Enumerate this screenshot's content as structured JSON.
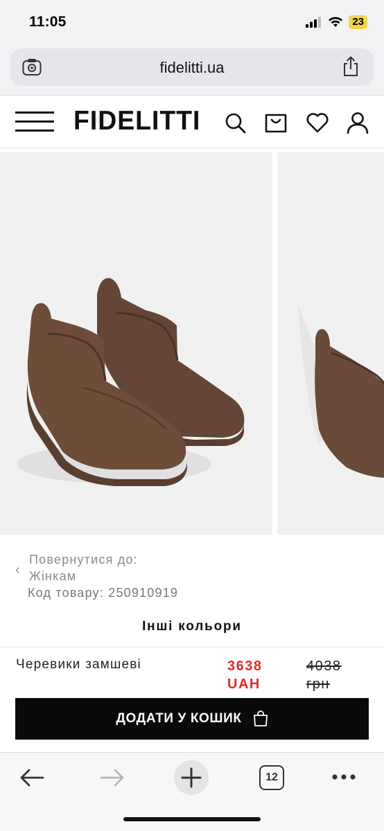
{
  "status": {
    "time": "11:05",
    "battery": "23"
  },
  "browser": {
    "url": "fidelitti.ua",
    "tab_count": "12"
  },
  "header": {
    "logo": "FIDELITTI"
  },
  "breadcrumb": {
    "back_label": "Повернутися до:",
    "back_target": "Жінкам"
  },
  "product": {
    "sku_line": "Код товару: 250910919",
    "other_colors_label": "Інші кольори",
    "name": "Черевики замшеві",
    "price_current_value": "3638",
    "price_current_currency": "UAH",
    "price_old_value": "4038",
    "price_old_currency": "грн"
  },
  "cart": {
    "add_button_label": "ДОДАТИ У КОШИК"
  },
  "colors": {
    "price_accent": "#e02a2a",
    "button_bg": "#0a0a0a",
    "shoe": "#6a4a38"
  }
}
